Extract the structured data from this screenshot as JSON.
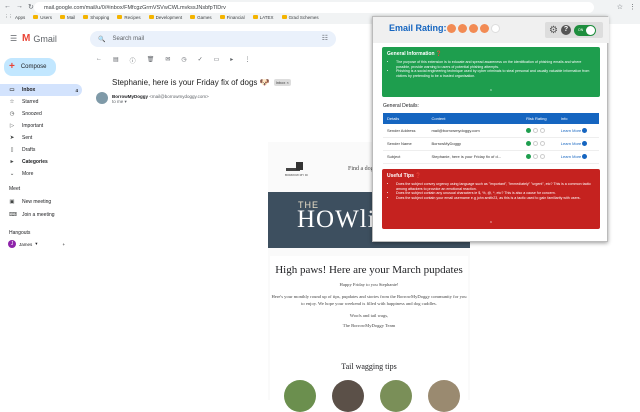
{
  "browser": {
    "url": "mail.google.com/mail/u/0/#inbox/FMfcgzGrmVSVwCWLmvkssJNsbfpTlDrv",
    "bookmarks": [
      "Apps",
      "Users",
      "Mail",
      "Shopping",
      "Recipes",
      "Development",
      "Games",
      "Financial",
      "LATEX",
      "Grad Schemes"
    ]
  },
  "gmail": {
    "logo_text": "Gmail",
    "search_placeholder": "Search mail",
    "compose": "Compose",
    "sidebar": [
      {
        "label": "Inbox",
        "count": "4",
        "icon": "inbox-icon"
      },
      {
        "label": "Starred",
        "icon": "star-icon"
      },
      {
        "label": "Snoozed",
        "icon": "clock-icon"
      },
      {
        "label": "Important",
        "icon": "important-icon"
      },
      {
        "label": "Sent",
        "icon": "send-icon"
      },
      {
        "label": "Drafts",
        "icon": "draft-icon"
      },
      {
        "label": "Categories",
        "icon": "tag-icon"
      },
      {
        "label": "More",
        "icon": "chevron-down-icon"
      }
    ],
    "meet": {
      "title": "Meet",
      "items": [
        "New meeting",
        "Join a meeting"
      ]
    },
    "hangouts": {
      "title": "Hangouts",
      "user": "James"
    }
  },
  "email": {
    "subject": "Stephanie, here is your Friday fix of dogs 🐶",
    "tag": "Inbox ×",
    "sender_name": "BorrowMyDoggy",
    "sender_email": "<mail@borrowmydoggy.com>",
    "to": "to me",
    "find_text": "Find a dog",
    "banner_the": "THE",
    "banner_title": "HOWling H",
    "headline": "High paws! Here are your March pupdates",
    "greeting": "Happy Friday to you Stephanie!",
    "para": "Here's your monthly round up of tips, pupdates and stories from the BorrowMyDoggy community for you to enjoy. We hope your weekend is filled with happiness and dog cuddles.",
    "signoff1": "Woofs and tail wags,",
    "signoff2": "The BorrowMyDoggy Team",
    "tail": "Tail wagging tips"
  },
  "popup": {
    "title": "Email Rating:",
    "rating": 4,
    "toggle": "ON",
    "info_title": "General Information ❓",
    "info_items": [
      "The purpose of this extension is to educate and spread awareness on the identification of phishing emails and where possible, provide warning to users of potential phishing attempts.",
      "Phishing is a social engineering technique used by cyber criminals to steal personal and usually valuable information from victims by pretending to be a trusted organisation."
    ],
    "details_title": "General Details:",
    "table_headers": [
      "Details",
      "Content",
      "Risk Rating",
      "Info"
    ],
    "rows": [
      {
        "d": "Sender Address",
        "c": "mail@borrowmydoggy.com",
        "info": "Learn More"
      },
      {
        "d": "Sender Name",
        "c": "BorrowMyDoggy",
        "info": "Learn More"
      },
      {
        "d": "Subject",
        "c": "Stephanie, here is your Friday fix of d...",
        "info": "Learn More"
      }
    ],
    "tips_title": "Useful Tips ❓",
    "tips": [
      "Does the subject convey urgency using language such as \"important\", \"immediately\" \"urgent\", etc? This is a common tactic among attackers to provoke an emotional reaction.",
      "Does the subject contain any unusual characters ie $, %, @, *, etc? This is also a cause for concern.",
      "Does the subject contain your email username e.g john.smith23, as this is a tactic used to gain familiarity with users."
    ]
  },
  "colors": {
    "green": "#1e9e4e",
    "red": "#c5221f",
    "blue": "#1565c0",
    "orange": "#f28b54"
  }
}
